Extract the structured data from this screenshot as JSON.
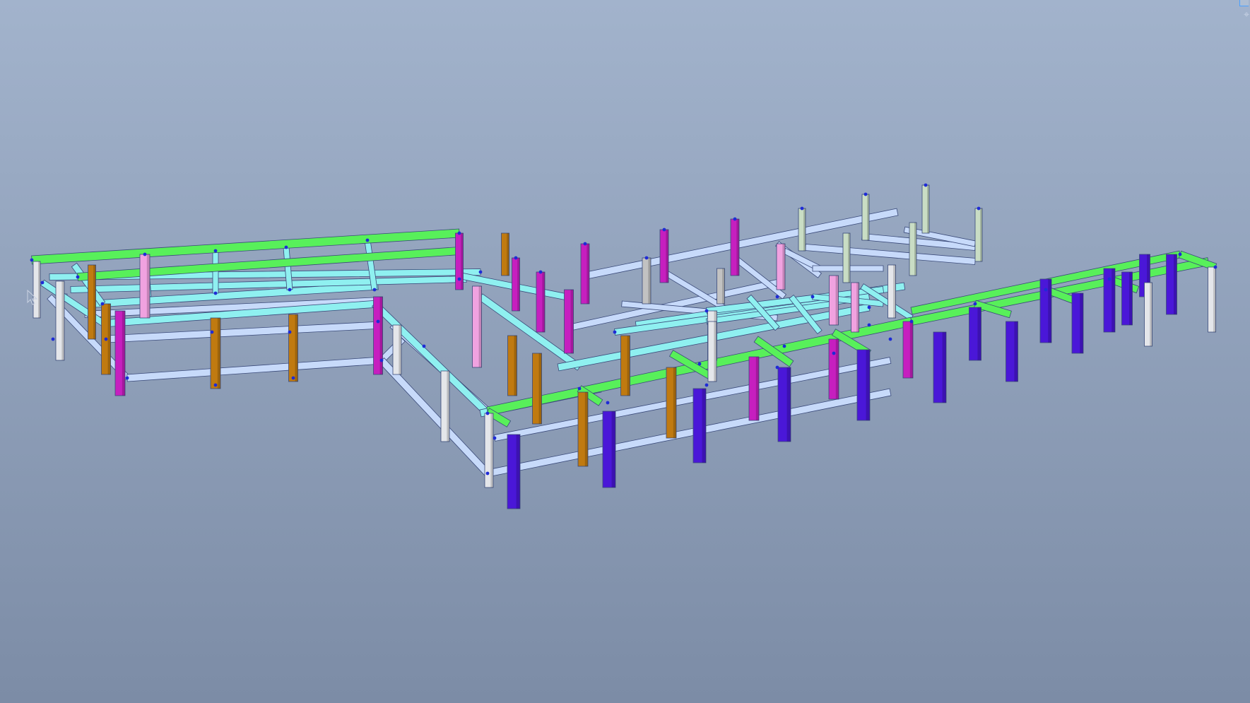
{
  "viewport": {
    "background_top": "#a2b3cc",
    "background_bottom": "#7c8ca6"
  },
  "palette": {
    "beam_light_blue": "#c7dafa",
    "beam_cyan": "#8ff0f0",
    "beam_green": "#58f05a",
    "column_magenta": "#c61fbf",
    "column_pink": "#f0a2e0",
    "column_orange": "#c07a10",
    "column_violet": "#4a17d8",
    "column_white": "#e4e6ea",
    "column_sage": "#c9ddc4",
    "column_grey": "#c2c2c2",
    "node_blue": "#1e2bd6",
    "edge_dark": "#3a4a7a"
  },
  "view_cube": {
    "icon": "view-cube-icon",
    "glyph": "⌖"
  },
  "cursor": {
    "icon": "arrow-cursor-icon"
  }
}
